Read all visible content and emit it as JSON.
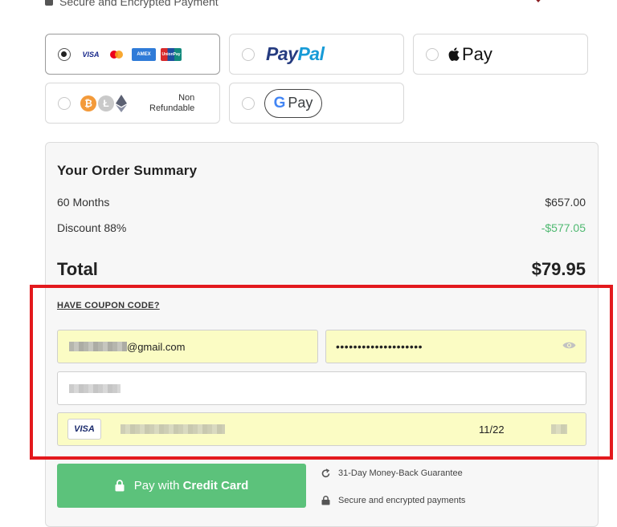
{
  "header": {
    "secure_text": "Secure and Encrypted Payment"
  },
  "payment_methods": {
    "card": {
      "cards": [
        "VISA",
        "mastercard",
        "AMEX",
        "UnionPay"
      ],
      "selected": true
    },
    "paypal": {
      "part1": "Pay",
      "part2": "Pal"
    },
    "applepay": {
      "label": "Pay"
    },
    "crypto": {
      "coins": [
        "bitcoin",
        "litecoin",
        "ethereum"
      ],
      "note_line1": "Non",
      "note_line2": "Refundable"
    },
    "googlepay": {
      "g": "G",
      "label": "Pay"
    }
  },
  "summary": {
    "title": "Your Order Summary",
    "line1_label": "60 Months",
    "line1_value": "$657.00",
    "line2_label": "Discount 88%",
    "line2_value": "-$577.05",
    "total_label": "Total",
    "total_value": "$79.95",
    "coupon_link": "HAVE COUPON CODE?"
  },
  "form": {
    "email_suffix": "@gmail.com",
    "password_mask": "••••••••••••••••••••",
    "card_brand": "VISA",
    "expiry": "11/22"
  },
  "pay_button": {
    "prefix": "Pay with",
    "emphasis": "Credit Card"
  },
  "guarantees": {
    "money_back": "31-Day Money-Back Guarantee",
    "secure": "Secure and encrypted payments"
  },
  "colors": {
    "accent_green": "#5cc27b",
    "discount_green": "#4fb971",
    "highlight_red": "#e3191d",
    "field_yellow": "#fbfcc4"
  }
}
